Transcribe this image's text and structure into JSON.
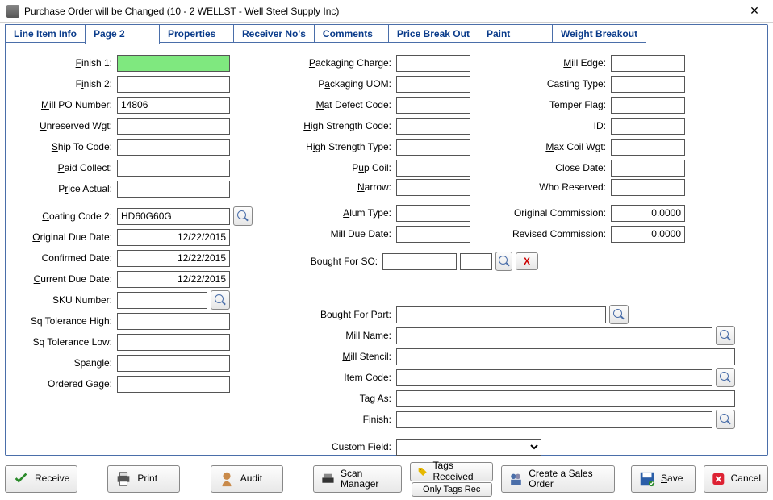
{
  "window": {
    "title": "Purchase Order will be Changed  (10 - 2  WELLST - Well Steel Supply Inc)"
  },
  "tabs": [
    "Line Item Info",
    "Page 2",
    "Properties",
    "Receiver No's",
    "Comments",
    "Price Break Out",
    "Paint",
    "Weight Breakout"
  ],
  "activeTab": "Page 2",
  "col1": {
    "finish1": {
      "label": "Finish 1:",
      "value": ""
    },
    "finish2": {
      "label": "Finish 2:",
      "value": ""
    },
    "millpo": {
      "label": "Mill PO Number:",
      "value": "14806"
    },
    "unreserved": {
      "label": "Unreserved Wgt:",
      "value": ""
    },
    "shipto": {
      "label": "Ship To Code:",
      "value": ""
    },
    "paid": {
      "label": "Paid Collect:",
      "value": ""
    },
    "priceactual": {
      "label": "Price Actual:",
      "value": ""
    },
    "coating2": {
      "label": "Coating Code 2:",
      "value": "HD60G60G"
    },
    "origdue": {
      "label": "Original Due Date:",
      "value": "12/22/2015"
    },
    "confdate": {
      "label": "Confirmed Date:",
      "value": "12/22/2015"
    },
    "currdue": {
      "label": "Current Due Date:",
      "value": "12/22/2015"
    },
    "sku": {
      "label": "SKU Number:",
      "value": ""
    },
    "tolhigh": {
      "label": "Sq Tolerance High:",
      "value": ""
    },
    "tollow": {
      "label": "Sq Tolerance Low:",
      "value": ""
    },
    "spangle": {
      "label": "Spangle:",
      "value": ""
    },
    "ordgage": {
      "label": "Ordered Gage:",
      "value": ""
    }
  },
  "col2": {
    "pkgcharge": {
      "label": "Packaging Charge:",
      "value": ""
    },
    "pkguom": {
      "label": "Packaging UOM:",
      "value": ""
    },
    "matdefect": {
      "label": "Mat Defect Code:",
      "value": ""
    },
    "hscode": {
      "label": "High Strength Code:",
      "value": ""
    },
    "hstype": {
      "label": "High Strength Type:",
      "value": ""
    },
    "pup": {
      "label": "Pup Coil:",
      "value": ""
    },
    "narrow": {
      "label": "Narrow:",
      "value": ""
    },
    "alum": {
      "label": "Alum Type:",
      "value": ""
    },
    "milldue": {
      "label": "Mill Due Date:",
      "value": ""
    },
    "boughtso": {
      "label": "Bought For SO:",
      "value": "",
      "value2": ""
    },
    "x": "X"
  },
  "col3": {
    "milledge": {
      "label": "Mill Edge:",
      "value": ""
    },
    "casting": {
      "label": "Casting Type:",
      "value": ""
    },
    "temper": {
      "label": "Temper Flag:",
      "value": ""
    },
    "id": {
      "label": "ID:",
      "value": ""
    },
    "maxcoil": {
      "label": "Max Coil Wgt:",
      "value": ""
    },
    "closedate": {
      "label": "Close Date:",
      "value": ""
    },
    "whores": {
      "label": "Who Reserved:",
      "value": ""
    },
    "origcomm": {
      "label": "Original Commission:",
      "value": "0.0000"
    },
    "revcomm": {
      "label": "Revised Commission:",
      "value": "0.0000"
    }
  },
  "wide": {
    "boughtpart": {
      "label": "Bought For Part:",
      "value": ""
    },
    "millname": {
      "label": "Mill Name:",
      "value": ""
    },
    "millstencil": {
      "label": "Mill Stencil:",
      "value": ""
    },
    "itemcode": {
      "label": "Item Code:",
      "value": ""
    },
    "tagas": {
      "label": "Tag As:",
      "value": ""
    },
    "finish": {
      "label": "Finish:",
      "value": ""
    },
    "custom": {
      "label": "Custom Field:",
      "value": ""
    }
  },
  "buttons": {
    "receive": "Receive",
    "print": "Print",
    "audit": "Audit",
    "scan": "Scan Manager",
    "tags": "Tags Received",
    "onlytags": "Only Tags Rec",
    "createso": "Create a Sales Order",
    "save": "Save",
    "cancel": "Cancel"
  }
}
